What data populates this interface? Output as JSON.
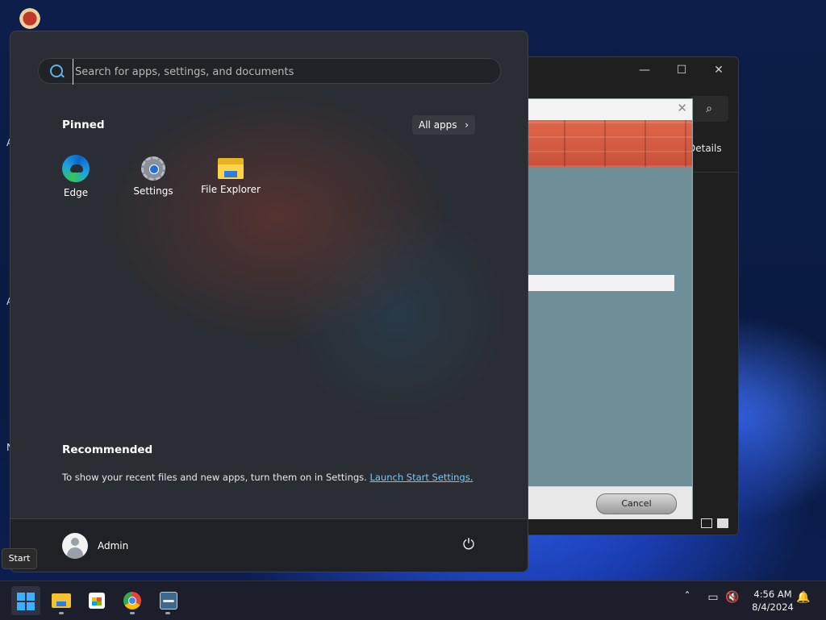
{
  "start_menu": {
    "search": {
      "placeholder": "Search for apps, settings, and documents",
      "value": ""
    },
    "pinned": {
      "heading": "Pinned",
      "all_apps_label": "All apps",
      "apps": [
        {
          "label": "Edge",
          "icon": "edge-icon"
        },
        {
          "label": "Settings",
          "icon": "gear-icon"
        },
        {
          "label": "File Explorer",
          "icon": "folder-icon"
        }
      ]
    },
    "recommended": {
      "heading": "Recommended",
      "message": "To show your recent files and new apps, turn them on in Settings.",
      "link_label": "Launch Start Settings."
    },
    "user": {
      "name": "Admin"
    }
  },
  "tooltip": {
    "text": "Start"
  },
  "background_window": {
    "details_label": "Details"
  },
  "installer_dialog": {
    "cancel_label": "Cancel"
  },
  "taskbar": {
    "items": [
      {
        "name": "start",
        "icon": "windows-logo-icon",
        "active": true
      },
      {
        "name": "file-explorer",
        "icon": "folder-icon"
      },
      {
        "name": "microsoft-store",
        "icon": "store-icon"
      },
      {
        "name": "chrome",
        "icon": "chrome-icon"
      },
      {
        "name": "installer",
        "icon": "installer-app-icon"
      }
    ],
    "clock": {
      "time": "4:56 AM",
      "date": "8/4/2024"
    }
  },
  "colors": {
    "accent": "#3ab0ff",
    "link": "#7cc7f0",
    "start_bg": "#2a2d33",
    "taskbar_bg": "#1c1f2b"
  }
}
